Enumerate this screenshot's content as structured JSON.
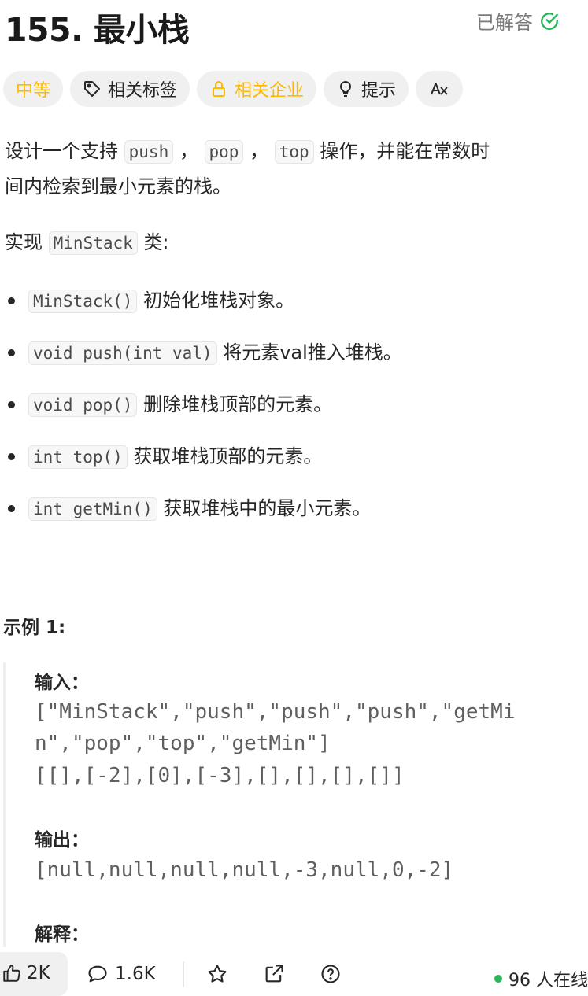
{
  "problem": {
    "title": "155. 最小栈",
    "status": "已解答"
  },
  "tags": {
    "difficulty": "中等",
    "related_tags": "相关标签",
    "related_companies": "相关企业",
    "hint": "提示",
    "translate_icon": "translate-icon"
  },
  "description": {
    "intro_prefix": "设计一个支持",
    "code_push": "push",
    "sep1": "，",
    "code_pop": "pop",
    "sep2": "，",
    "code_top": "top",
    "intro_suffix_line1": "操作，并能在常数时",
    "intro_line2": "间内检索到最小元素的栈。",
    "impl_prefix": "实现",
    "impl_code": "MinStack",
    "impl_suffix": "类:",
    "bullets": [
      {
        "code": "MinStack()",
        "text": "初始化堆栈对象。"
      },
      {
        "code": "void push(int val)",
        "text": "将元素val推入堆栈。"
      },
      {
        "code": "void pop()",
        "text": "删除堆栈顶部的元素。"
      },
      {
        "code": "int top()",
        "text": "获取堆栈顶部的元素。"
      },
      {
        "code": "int getMin()",
        "text": "获取堆栈中的最小元素。"
      }
    ]
  },
  "example": {
    "title": "示例 1:",
    "input_label": "输入：",
    "input_line1": "[\"MinStack\",\"push\",\"push\",\"push\",\"getMi",
    "input_line2": "n\",\"pop\",\"top\",\"getMin\"]",
    "input_line3": "[[],[-2],[0],[-3],[],[],[],[]]",
    "output_label": "输出：",
    "output_line": "[null,null,null,null,-3,null,0,-2]",
    "explain_label": "解释："
  },
  "bottom_bar": {
    "likes": "2K",
    "comments": "1.6K",
    "online": "96 人在线",
    "online_color": "#2db55d"
  }
}
